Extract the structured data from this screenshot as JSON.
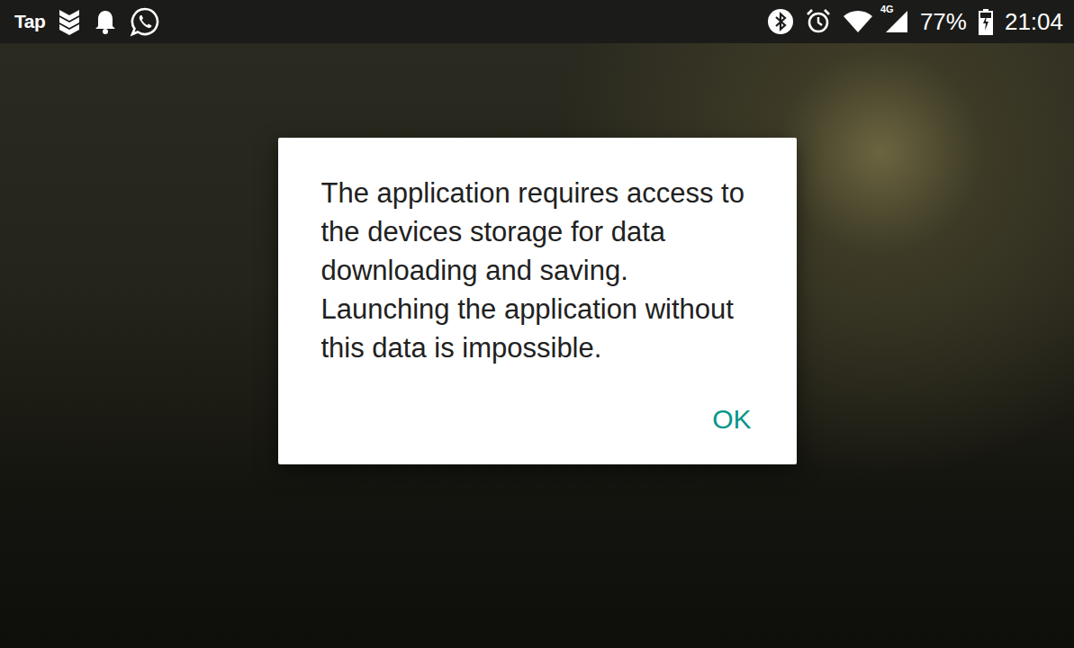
{
  "status_bar": {
    "left_text": "Tap",
    "network": "4G",
    "battery": "77%",
    "battery_level": 0.77,
    "time": "21:04"
  },
  "dialog": {
    "message": "The application requires access to the devices storage for data downloading and saving. Launching the application without this data is impossible."
  },
  "buttons": [
    "OK"
  ]
}
